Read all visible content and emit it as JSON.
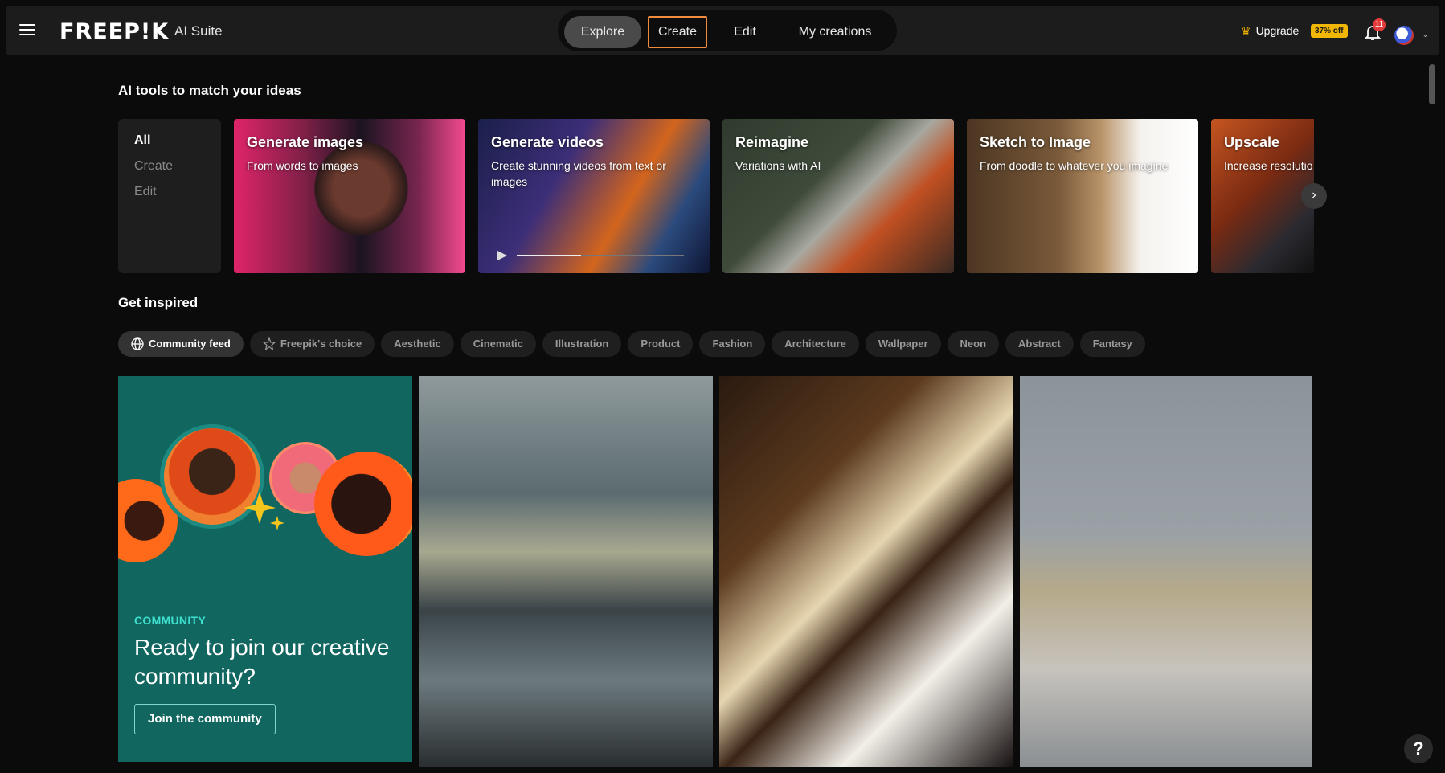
{
  "header": {
    "logo": "FREEP!K",
    "suite": "AI Suite",
    "tabs": [
      "Explore",
      "Create",
      "Edit",
      "My creations"
    ],
    "upgrade": "Upgrade",
    "discount": "37% off",
    "notifications": "11"
  },
  "tools": {
    "heading": "AI tools to match your ideas",
    "filters": [
      "All",
      "Create",
      "Edit"
    ],
    "cards": [
      {
        "title": "Generate images",
        "subtitle": "From words to images"
      },
      {
        "title": "Generate videos",
        "subtitle": "Create stunning videos from text or images"
      },
      {
        "title": "Reimagine",
        "subtitle": "Variations with AI"
      },
      {
        "title": "Sketch to Image",
        "subtitle": "From doodle to whatever you imagine"
      },
      {
        "title": "Upscale",
        "subtitle": "Increase resolutio"
      }
    ]
  },
  "inspired": {
    "heading": "Get inspired",
    "chips": [
      "Community feed",
      "Freepik's choice",
      "Aesthetic",
      "Cinematic",
      "Illustration",
      "Product",
      "Fashion",
      "Architecture",
      "Wallpaper",
      "Neon",
      "Abstract",
      "Fantasy"
    ]
  },
  "community": {
    "tag": "COMMUNITY",
    "title": "Ready to join our creative community?",
    "button": "Join the community"
  },
  "help": "?"
}
